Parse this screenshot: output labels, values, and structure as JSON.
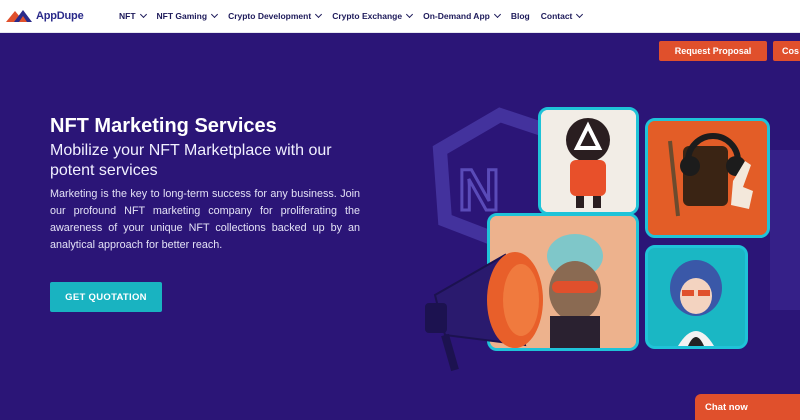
{
  "brand": {
    "name": "AppDupe"
  },
  "nav": {
    "items": [
      {
        "label": "NFT",
        "dropdown": true
      },
      {
        "label": "NFT Gaming",
        "dropdown": true
      },
      {
        "label": "Crypto Development",
        "dropdown": true
      },
      {
        "label": "Crypto Exchange",
        "dropdown": true
      },
      {
        "label": "On-Demand App",
        "dropdown": true
      },
      {
        "label": "Blog",
        "dropdown": false
      },
      {
        "label": "Contact",
        "dropdown": true
      }
    ]
  },
  "cta": {
    "request_label": "Request Proposal",
    "cost_label": "Cos"
  },
  "hero": {
    "title": "NFT Marketing Services",
    "subtitle": "Mobilize your NFT Marketplace with our potent services",
    "description": "Marketing is the key to long-term success for any business. Join our profound NFT marketing company for proliferating the awareness of your unique NFT collections backed up by an analytical approach for better reach.",
    "button_label": "GET QUOTATION"
  },
  "chat": {
    "label": "Chat now"
  },
  "colors": {
    "background": "#2b1577",
    "accent_orange": "#e0502c",
    "accent_teal": "#19b3c1",
    "card_border": "#1fc3d8"
  },
  "icons": [
    "logo-icon",
    "chevron-down-icon",
    "megaphone-icon"
  ]
}
